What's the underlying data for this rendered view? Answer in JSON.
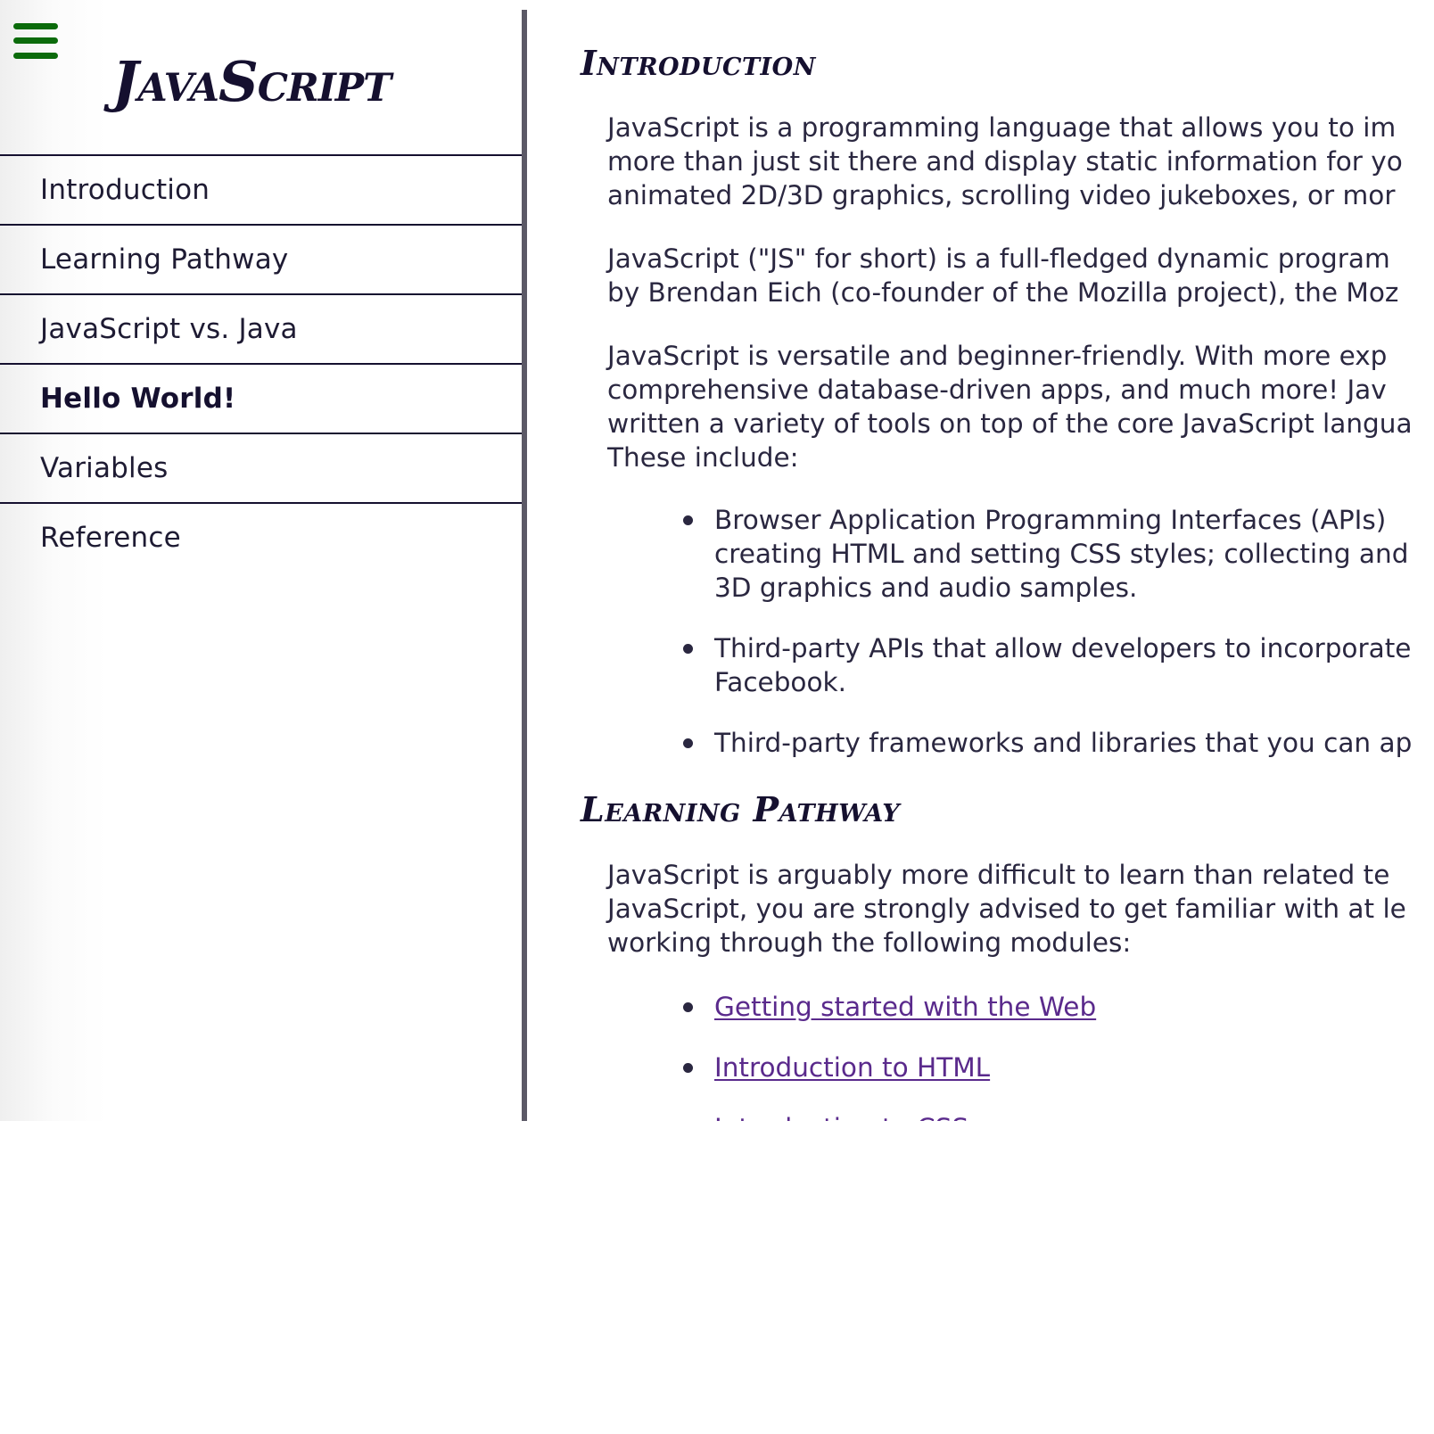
{
  "sidebar": {
    "brand": "JavaScript",
    "menu_icon": "hamburger-menu-icon",
    "items": [
      {
        "label": "Introduction",
        "active": false
      },
      {
        "label": "Learning Pathway",
        "active": false
      },
      {
        "label": "JavaScript vs. Java",
        "active": false
      },
      {
        "label": "Hello World!",
        "active": true
      },
      {
        "label": "Variables",
        "active": false
      },
      {
        "label": "Reference",
        "active": false
      }
    ]
  },
  "main": {
    "intro": {
      "title": "Introduction",
      "p1": [
        "JavaScript is a programming language that allows you to im",
        "more than just sit there and display static information for yo",
        "animated 2D/3D graphics, scrolling video jukeboxes, or mor"
      ],
      "p2": [
        "JavaScript (\"JS\" for short) is a full-fledged dynamic program",
        "by Brendan Eich (co-founder of the Mozilla project), the Moz"
      ],
      "p3": [
        "JavaScript is versatile and beginner-friendly. With more exp",
        "comprehensive database-driven apps, and much more! Jav",
        "written a variety of tools on top of the core JavaScript langua",
        "These include:"
      ],
      "list": [
        [
          "Browser Application Programming Interfaces (APIs)",
          "creating HTML and setting CSS styles; collecting and",
          "3D graphics and audio samples."
        ],
        [
          "Third-party APIs that allow developers to incorporate",
          "Facebook."
        ],
        [
          "Third-party frameworks and libraries that you can ap"
        ]
      ]
    },
    "pathway": {
      "title": "Learning Pathway",
      "p1": [
        "JavaScript is arguably more difficult to learn than related te",
        "JavaScript, you are strongly advised to get familiar with at le",
        "working through the following modules:"
      ],
      "links": [
        "Getting started with the Web",
        "Introduction to HTML",
        "Introduction to CSS"
      ]
    }
  },
  "colors": {
    "text": "#2a2740",
    "heading": "#15102f",
    "menu_icon": "#0b6b0b",
    "link": "#5a2a8c",
    "sidebar_border": "#5b5966"
  }
}
